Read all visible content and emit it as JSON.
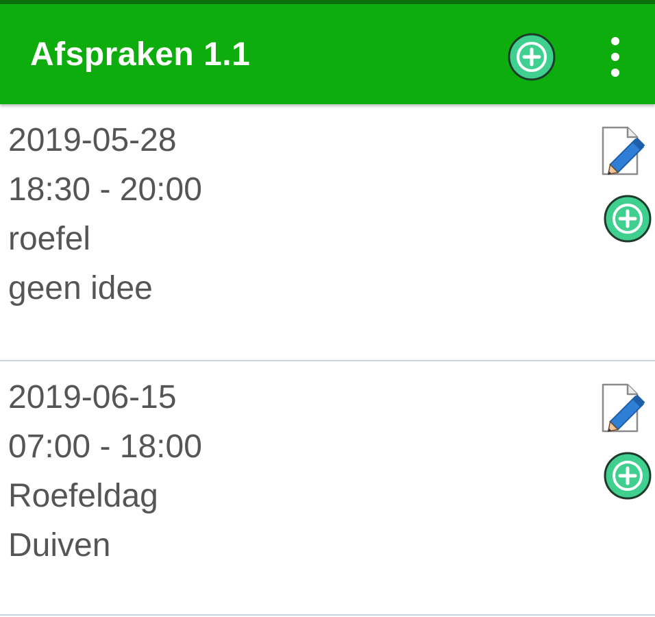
{
  "app": {
    "title": "Afspraken 1.1"
  },
  "toolbar": {
    "add_icon": "plus-circle-icon",
    "menu_icon": "more-vert-icon"
  },
  "appointments": [
    {
      "date": "2019-05-28",
      "time": "18:30 - 20:00",
      "title": "roefel",
      "description": "geen idee"
    },
    {
      "date": "2019-06-15",
      "time": "07:00 - 18:00",
      "title": "Roefeldag",
      "description": "Duiven"
    }
  ],
  "colors": {
    "toolbar": "#0ead0e",
    "status_strip": "#0a6f0a",
    "add_circle": "#3fcf8e",
    "text": "#555555",
    "divider": "#c9d3db",
    "pencil": "#2f7fd6"
  }
}
